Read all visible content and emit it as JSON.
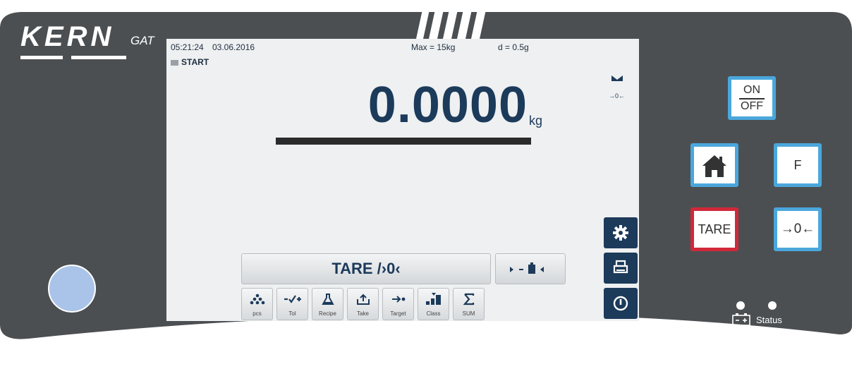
{
  "brand": {
    "name": "KERN",
    "model": "GAT"
  },
  "display": {
    "time": "05:21:24",
    "date": "03.06.2016",
    "max": "Max = 15kg",
    "d": "d = 0.5g",
    "mode": "START",
    "weight": "0.0000",
    "unit": "kg",
    "zero_indicator": "→0←",
    "tare_label": "TARE /›0‹"
  },
  "function_keys": [
    {
      "label": "pcs",
      "icon": "pieces-icon"
    },
    {
      "label": "Tol",
      "icon": "tolerance-icon"
    },
    {
      "label": "Recipe",
      "icon": "flask-icon"
    },
    {
      "label": "Take",
      "icon": "take-icon"
    },
    {
      "label": "Target",
      "icon": "target-icon"
    },
    {
      "label": "Class",
      "icon": "class-icon"
    },
    {
      "label": "SUM",
      "icon": "sigma-icon"
    }
  ],
  "side_buttons": [
    "gear-icon",
    "print-icon",
    "power-icon"
  ],
  "hardware": {
    "on": "ON",
    "off": "OFF",
    "f": "F",
    "tare": "TARE",
    "zero": "→0←",
    "status": "Status"
  },
  "colors": {
    "panel": "#4c4f52",
    "screen": "#eef0f1",
    "navy": "#1c3a5a",
    "blue_border": "#4aa7dc",
    "red_border": "#d1283a"
  }
}
